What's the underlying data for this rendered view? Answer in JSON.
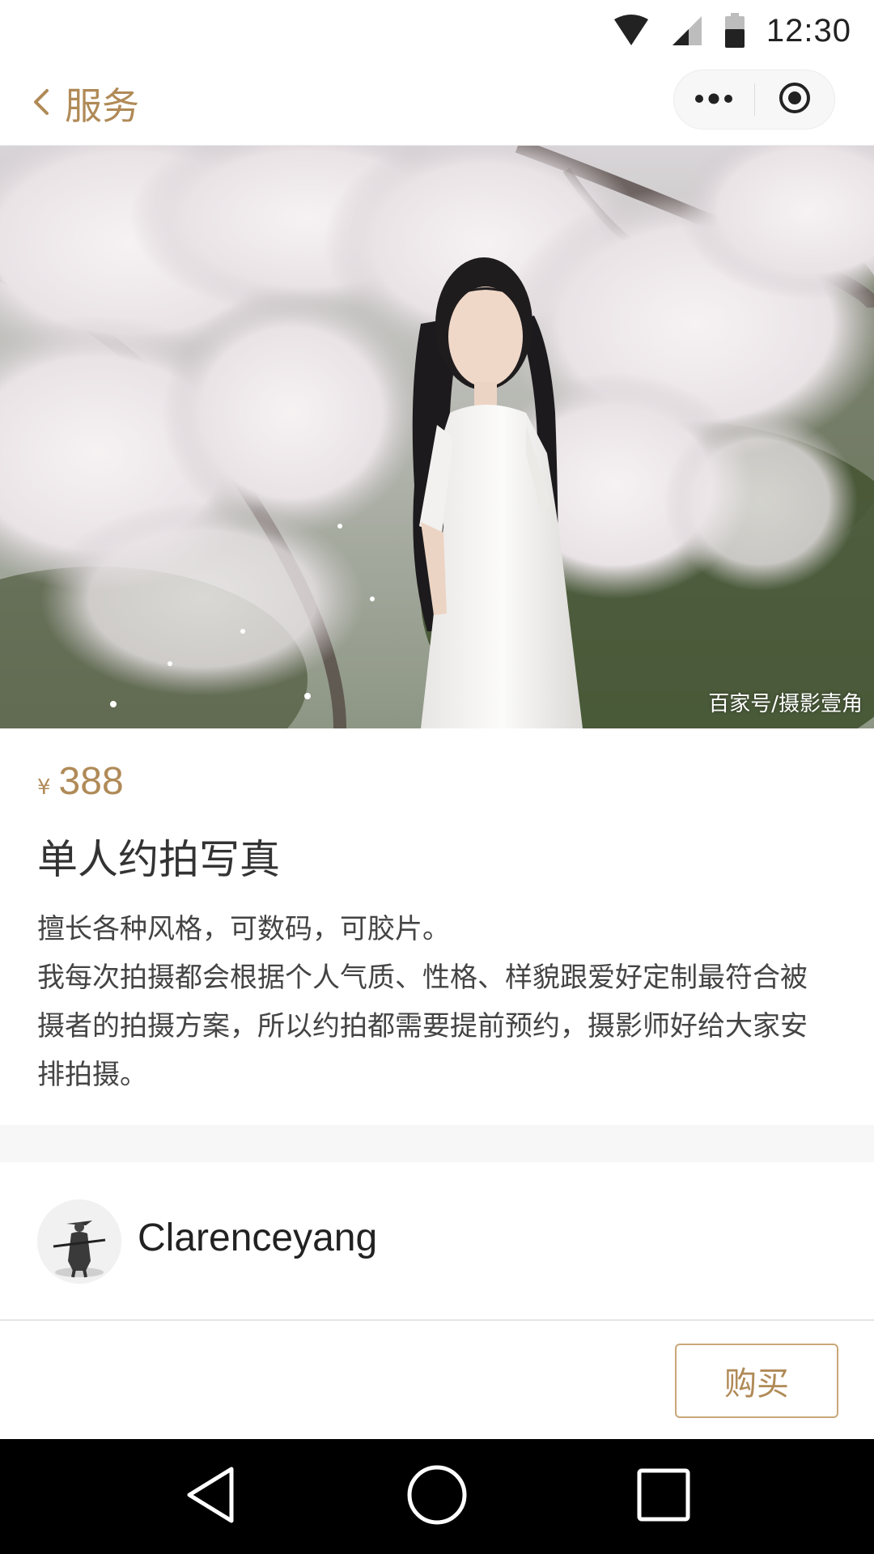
{
  "status_bar": {
    "time": "12:30",
    "icons": [
      "wifi-icon",
      "cell-signal-icon",
      "battery-icon"
    ]
  },
  "nav": {
    "back_icon": "chevron-left-icon",
    "title": "服务",
    "capsule": {
      "more_icon": "more-dots-icon",
      "close_icon": "target-close-icon"
    }
  },
  "hero": {
    "watermark": "百家号/摄影壹角"
  },
  "product": {
    "currency": "¥",
    "price": "388",
    "title": "单人约拍写真",
    "description_line1": "擅长各种风格，可数码，可胶片。",
    "description_line2": "我每次拍摄都会根据个人气质、性格、样貌跟爱好定制最符合被摄者的拍摄方案，所以约拍都需要提前预约，摄影师好给大家安排拍摄。"
  },
  "author": {
    "name": "Clarenceyang"
  },
  "actions": {
    "buy_label": "购买"
  },
  "system_nav": {
    "icons": [
      "back-triangle-icon",
      "home-circle-icon",
      "recents-square-icon"
    ]
  },
  "colors": {
    "accent": "#b08a57",
    "button_border": "#c9a878",
    "text": "#333333"
  }
}
